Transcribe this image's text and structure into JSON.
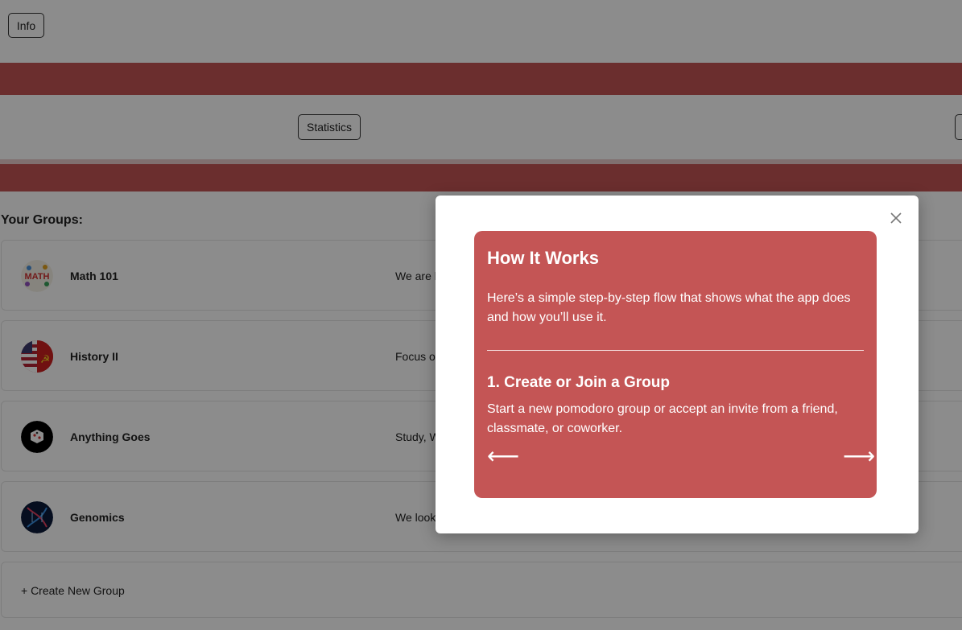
{
  "header": {
    "info_label": "Info"
  },
  "nav": {
    "statistics_label": "Statistics"
  },
  "groups": {
    "heading": "Your Groups:",
    "items": [
      {
        "name": "Math 101",
        "desc": "We are l",
        "icon": "math-icon"
      },
      {
        "name": "History II",
        "desc": "Focus o",
        "icon": "flag-globe-icon"
      },
      {
        "name": "Anything Goes",
        "desc": "Study, W",
        "icon": "dice-icon"
      },
      {
        "name": "Genomics",
        "desc": "We look",
        "icon": "dna-icon"
      }
    ],
    "create_label": "+ Create New Group"
  },
  "modal": {
    "title": "How It Works",
    "intro": "Here’s a simple step-by-step flow that shows what the app does and how you’ll use it.",
    "step_title": "1. Create or Join a Group",
    "step_desc": "Start a new pomodoro group or accept an invite from a friend, classmate, or coworker.",
    "prev_arrow": "⟵",
    "next_arrow": "⟶",
    "close_icon": "close-icon"
  },
  "colors": {
    "accent": "#c45555",
    "overlay": "rgba(0,0,0,0.45)"
  }
}
